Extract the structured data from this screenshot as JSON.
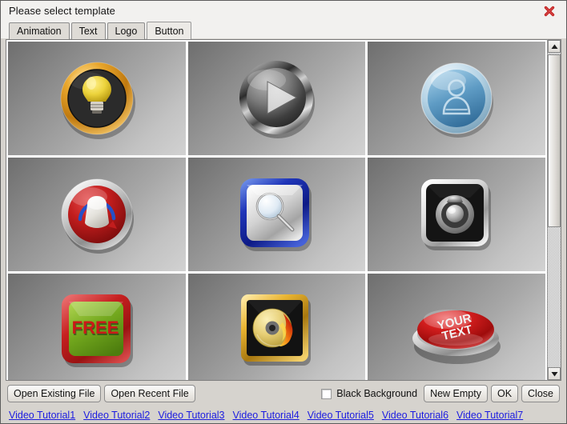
{
  "window": {
    "title": "Please select template",
    "close_icon": "close-x-icon"
  },
  "tabs": [
    {
      "label": "Animation",
      "active": false
    },
    {
      "label": "Text",
      "active": false
    },
    {
      "label": "Logo",
      "active": false
    },
    {
      "label": "Button",
      "active": true
    }
  ],
  "templates": [
    {
      "name": "lightbulb-gold-ring-button",
      "caption": ""
    },
    {
      "name": "chrome-play-button",
      "caption": ""
    },
    {
      "name": "blue-user-glossy-button",
      "caption": ""
    },
    {
      "name": "red-knob-dial-button",
      "caption": ""
    },
    {
      "name": "blue-frame-search-button",
      "caption": ""
    },
    {
      "name": "black-speaker-button",
      "caption": ""
    },
    {
      "name": "green-free-button",
      "caption": "FREE"
    },
    {
      "name": "gold-frame-burning-disc-button",
      "caption": ""
    },
    {
      "name": "red-dome-your-text-button",
      "caption": "YOUR TEXT"
    }
  ],
  "scrollbar": {
    "up_icon": "arrow-up-icon",
    "down_icon": "arrow-down-icon",
    "thumb_position": "top"
  },
  "actionbar": {
    "open_existing_file": "Open Existing File",
    "open_recent_file": "Open Recent File",
    "black_background_label": "Black Background",
    "black_background_checked": false,
    "new_empty": "New Empty",
    "ok": "OK",
    "close": "Close"
  },
  "tutorial_links": [
    "Video Tutorial1",
    "Video Tutorial2",
    "Video Tutorial3",
    "Video Tutorial4",
    "Video Tutorial5",
    "Video Tutorial6",
    "Video Tutorial7"
  ],
  "colors": {
    "dialog_bg": "#d6d3ce",
    "titlebar_bg": "#f2f1ef",
    "close_red": "#cc2222",
    "link_blue": "#1c1ce0",
    "cell_gradient_dark": "#6e6e6e",
    "cell_gradient_light": "#d2d2d2"
  }
}
